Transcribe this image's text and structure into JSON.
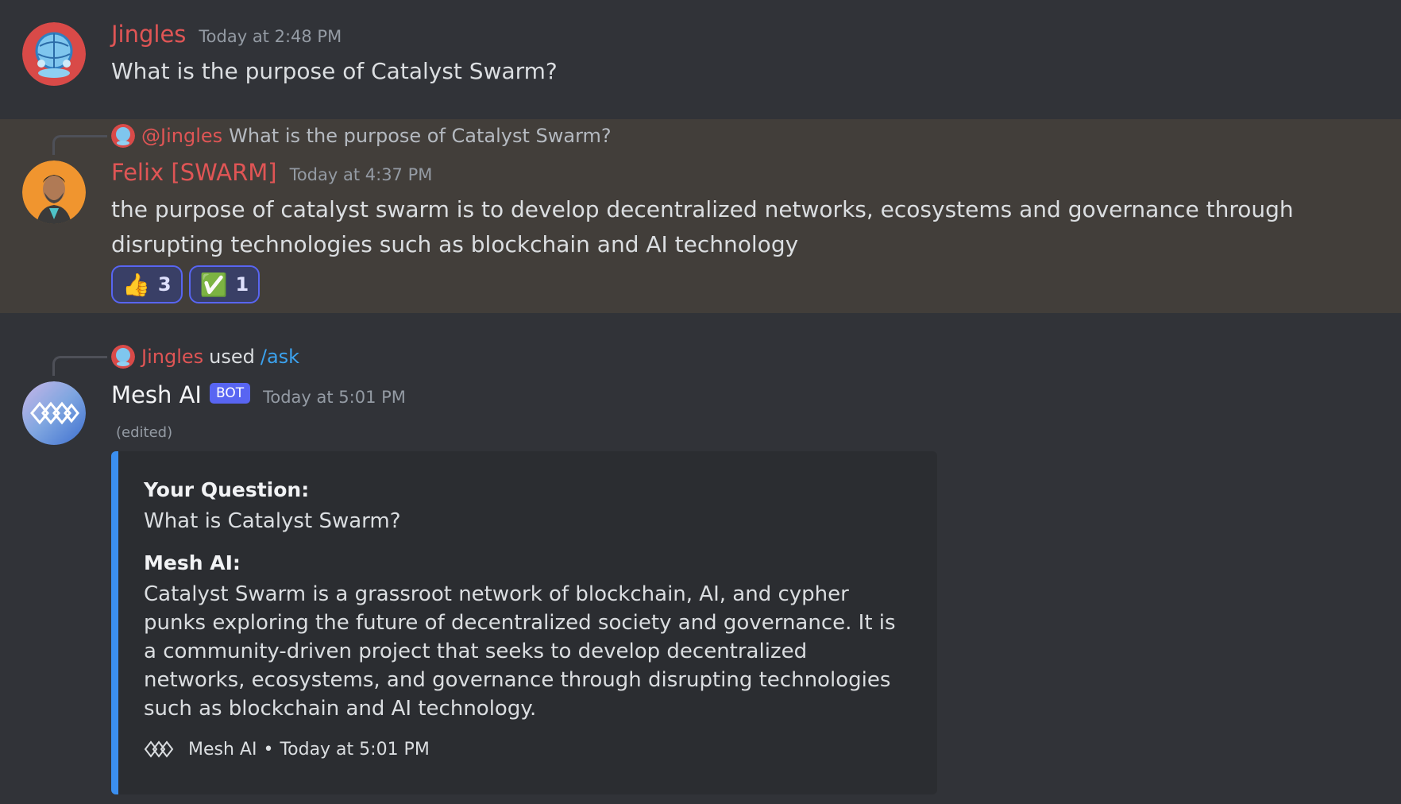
{
  "colors": {
    "background": "#313338",
    "highlight": "#423e3a",
    "username_red": "#e05555",
    "link_blue": "#3ba3f0",
    "embed_accent": "#3b8ff0",
    "reaction_border": "#5865f2"
  },
  "messages": [
    {
      "author": "Jingles",
      "timestamp": "Today at 2:48 PM",
      "content": "What is the purpose of Catalyst Swarm?",
      "avatar_icon": "crystal-ball-avatar"
    },
    {
      "reply_mention": "@Jingles",
      "reply_text": "What is the purpose of Catalyst Swarm?",
      "author": "Felix [SWARM]",
      "timestamp": "Today at 4:37 PM",
      "content": "the purpose of catalyst swarm is to develop decentralized networks, ecosystems and governance through disrupting technologies such as blockchain and AI technology",
      "avatar_icon": "person-avatar",
      "reactions": [
        {
          "emoji": "👍",
          "icon": "thumbs-up-icon",
          "count": "3"
        },
        {
          "emoji": "✅",
          "icon": "check-mark-icon",
          "count": "1"
        }
      ]
    },
    {
      "interaction_user": "Jingles",
      "interaction_used": "used",
      "interaction_command": "/ask",
      "author": "Mesh AI",
      "bot_tag": "BOT",
      "timestamp": "Today at 5:01 PM",
      "edited": "(edited)",
      "avatar_icon": "mesh-ai-logo-avatar",
      "embed": {
        "question_label": "Your Question:",
        "question": "What is Catalyst Swarm?",
        "answer_label": "Mesh AI:",
        "answer": "Catalyst Swarm is a grassroot network of blockchain, AI, and cypher punks exploring the future of decentralized society and governance. It is a community-driven project that seeks to develop decentralized networks, ecosystems, and governance through disrupting technologies such as blockchain and AI technology.",
        "footer_name": "Mesh AI",
        "footer_separator": "•",
        "footer_time": "Today at 5:01 PM",
        "footer_icon": "mesh-ai-logo-icon"
      }
    }
  ]
}
